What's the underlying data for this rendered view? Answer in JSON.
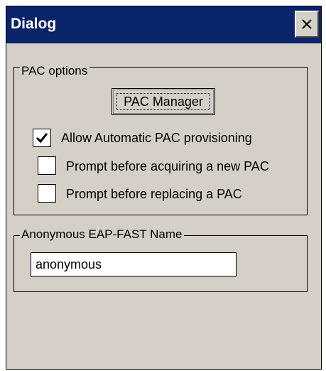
{
  "window": {
    "title": "Dialog",
    "close_icon": "close-icon"
  },
  "pac_options": {
    "group_label": "PAC options",
    "pac_manager_label": "PAC Manager",
    "checkboxes": [
      {
        "label": "Allow Automatic PAC provisioning",
        "checked": true
      },
      {
        "label": "Prompt before acquiring a new PAC",
        "checked": false
      },
      {
        "label": "Prompt before replacing a PAC",
        "checked": false
      }
    ]
  },
  "anonymous": {
    "group_label": "Anonymous EAP-FAST Name",
    "name_value": "anonymous"
  },
  "colors": {
    "titlebar": "#0a246a",
    "window_face": "#d4d0c8"
  }
}
